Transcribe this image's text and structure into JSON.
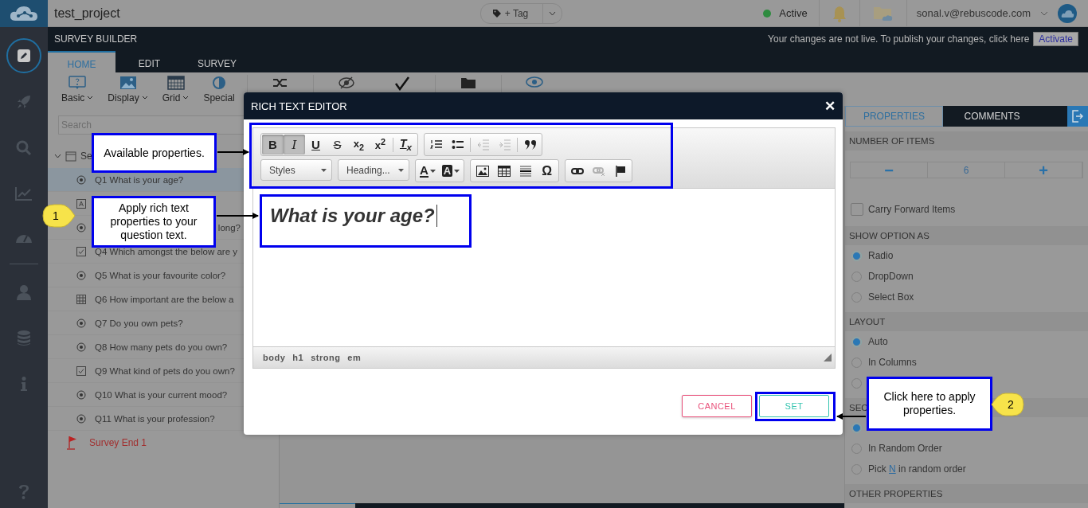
{
  "app_bar": {
    "project": "test_project",
    "tag_button": "+ Tag",
    "status": "Active",
    "user": "sonal.v@rebuscode.com"
  },
  "builder": {
    "title": "SURVEY BUILDER",
    "notice": "Your changes are not live. To publish your changes, click here",
    "activate": "Activate"
  },
  "tabs": [
    {
      "label": "HOME",
      "selected": true
    },
    {
      "label": "EDIT",
      "selected": false
    },
    {
      "label": "SURVEY",
      "selected": false
    }
  ],
  "ribbon": [
    {
      "kind": "basic",
      "label": "Basic",
      "dropdown": true
    },
    {
      "kind": "display",
      "label": "Display",
      "dropdown": true
    },
    {
      "kind": "grid",
      "label": "Grid",
      "dropdown": true
    },
    {
      "kind": "special",
      "label": "Special",
      "dropdown": false
    }
  ],
  "outline": {
    "search_placeholder": "Search",
    "section": "Se",
    "items": [
      {
        "kind": "radio",
        "text": "Q1 What is your age?",
        "selected": true
      },
      {
        "kind": "text",
        "selected": false
      },
      {
        "kind": "radio",
        "text": "long?",
        "clipped_start": true,
        "selected": false
      },
      {
        "kind": "checkbox",
        "text": "Q4 Which amongst the below are y",
        "selected": false
      },
      {
        "kind": "radio",
        "text": "Q5 What is your favourite color?",
        "selected": false
      },
      {
        "kind": "grid",
        "text": "Q6 How important are the below a",
        "selected": false
      },
      {
        "kind": "radio",
        "text": "Q7 Do you own pets?",
        "selected": false
      },
      {
        "kind": "radio",
        "text": "Q8 How many pets do you own?",
        "selected": false
      },
      {
        "kind": "checkbox",
        "text": "Q9 What kind of pets do you own?",
        "selected": false
      },
      {
        "kind": "radio",
        "text": "Q10 What is your current mood?",
        "selected": false
      },
      {
        "kind": "radio",
        "text": "Q11 What is your profession?",
        "selected": false
      }
    ],
    "end": "Survey End 1"
  },
  "properties": {
    "tabs": [
      {
        "label": "PROPERTIES",
        "selected": true
      },
      {
        "label": "COMMENTS",
        "selected": false
      }
    ],
    "items": [
      {
        "kind": "header",
        "title": "NUMBER OF ITEMS"
      },
      {
        "kind": "stepper",
        "value": "6",
        "minus": "−",
        "plus": "+"
      },
      {
        "kind": "checkbox",
        "label": "Carry Forward Items",
        "checked": false
      },
      {
        "kind": "header",
        "title": "SHOW OPTION AS"
      },
      {
        "kind": "radio",
        "label": "Radio",
        "selected": true
      },
      {
        "kind": "radio",
        "label": "DropDown",
        "selected": false
      },
      {
        "kind": "radio",
        "label": "Select Box",
        "selected": false
      },
      {
        "kind": "header",
        "title": "LAYOUT"
      },
      {
        "kind": "radio",
        "label": "Auto",
        "selected": true
      },
      {
        "kind": "radio",
        "label": "In Columns",
        "selected": false
      },
      {
        "kind": "radio",
        "selected": false
      },
      {
        "kind": "header",
        "title": "SEC"
      },
      {
        "kind": "radio",
        "selected": true
      },
      {
        "kind": "radio",
        "label": "In Random Order",
        "selected": false
      },
      {
        "kind": "radio",
        "label": "Pick",
        "link": "N",
        "label_after": "in random order",
        "selected": false
      },
      {
        "kind": "header",
        "title": "OTHER PROPERTIES"
      }
    ]
  },
  "editor": {
    "title": "RICH TEXT EDITOR",
    "close": "✕",
    "toolbar": [
      {
        "groups": [
          {
            "buttons": [
              {
                "kind": "bold",
                "glyph": "B",
                "on": true,
                "disabled": false
              },
              {
                "kind": "italic",
                "glyph": "I",
                "on": true,
                "disabled": false
              },
              {
                "kind": "underline",
                "glyph": "U",
                "on": false,
                "disabled": false
              },
              {
                "kind": "strike",
                "glyph": "S",
                "on": false,
                "disabled": false
              },
              {
                "kind": "subscript",
                "glyph": "x$_{2}$",
                "on": false,
                "disabled": false
              },
              {
                "kind": "superscript",
                "glyph": "x$^{2}$",
                "on": false,
                "disabled": false
              },
              {
                "kind": "clear-format",
                "glyph": "T$_{x}$",
                "separator": true,
                "on": false,
                "disabled": false
              }
            ]
          },
          {
            "buttons": [
              {
                "kind": "numbered-list",
                "on": false,
                "disabled": false
              },
              {
                "kind": "bulleted-list",
                "on": false,
                "disabled": false
              },
              {
                "kind": "outdent",
                "separator": true,
                "on": false,
                "disabled": true
              },
              {
                "kind": "indent",
                "on": false,
                "disabled": true
              },
              {
                "kind": "blockquote",
                "separator": true,
                "on": false,
                "disabled": false
              }
            ]
          }
        ]
      },
      {
        "groups": [
          {
            "buttons": [
              {
                "kind": "combo",
                "label": "Styles",
                "on": false,
                "disabled": false
              }
            ]
          },
          {
            "buttons": [
              {
                "kind": "combo",
                "label": "Heading...",
                "on": false,
                "disabled": false
              }
            ]
          },
          {
            "buttons": [
              {
                "kind": "text-color",
                "glyph": "A",
                "on": false,
                "disabled": false
              },
              {
                "kind": "background-color",
                "glyph": "A",
                "on": false,
                "disabled": false
              }
            ]
          },
          {
            "buttons": [
              {
                "kind": "image",
                "on": false,
                "disabled": false
              },
              {
                "kind": "table",
                "on": false,
                "disabled": false
              },
              {
                "kind": "horizontal-line",
                "on": false,
                "disabled": false
              },
              {
                "kind": "special-char",
                "glyph": "Ω",
                "on": false,
                "disabled": false
              }
            ]
          },
          {
            "buttons": [
              {
                "kind": "link",
                "on": false,
                "disabled": false
              },
              {
                "kind": "unlink",
                "on": false,
                "disabled": true
              },
              {
                "kind": "anchor",
                "on": false,
                "disabled": false
              }
            ]
          }
        ]
      }
    ],
    "content": "What is your age?",
    "path": [
      "body",
      "h1",
      "strong",
      "em"
    ],
    "cancel": "CANCEL",
    "set": "SET"
  },
  "callouts": [
    {
      "text": "Available properties."
    },
    {
      "text": "Apply rich text properties to your question text.",
      "step": "1"
    },
    {
      "text": "Click here to apply properties.",
      "step": "2"
    }
  ]
}
